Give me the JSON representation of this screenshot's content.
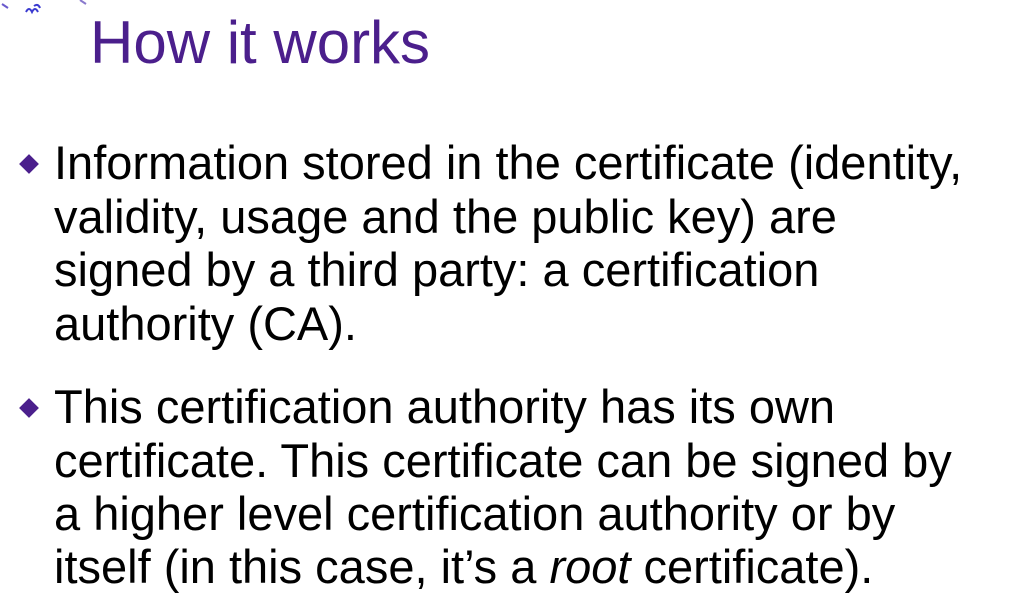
{
  "slide": {
    "title": "How it works",
    "accent_color": "#4b1f8c",
    "bullets": [
      {
        "lines": [
          "Information stored in the certificate (identity,",
          "validity, usage and the public key) are",
          "signed by a third party: a certification",
          "authority (CA)."
        ]
      },
      {
        "lines_plain": [
          "This certification authority has its own",
          "certificate. This certificate can be signed by",
          "a higher level certification authority or by"
        ],
        "last_line": {
          "before": "itself (in this case, it’s a ",
          "emphasis": "root",
          "after": " certificate)."
        }
      }
    ]
  }
}
